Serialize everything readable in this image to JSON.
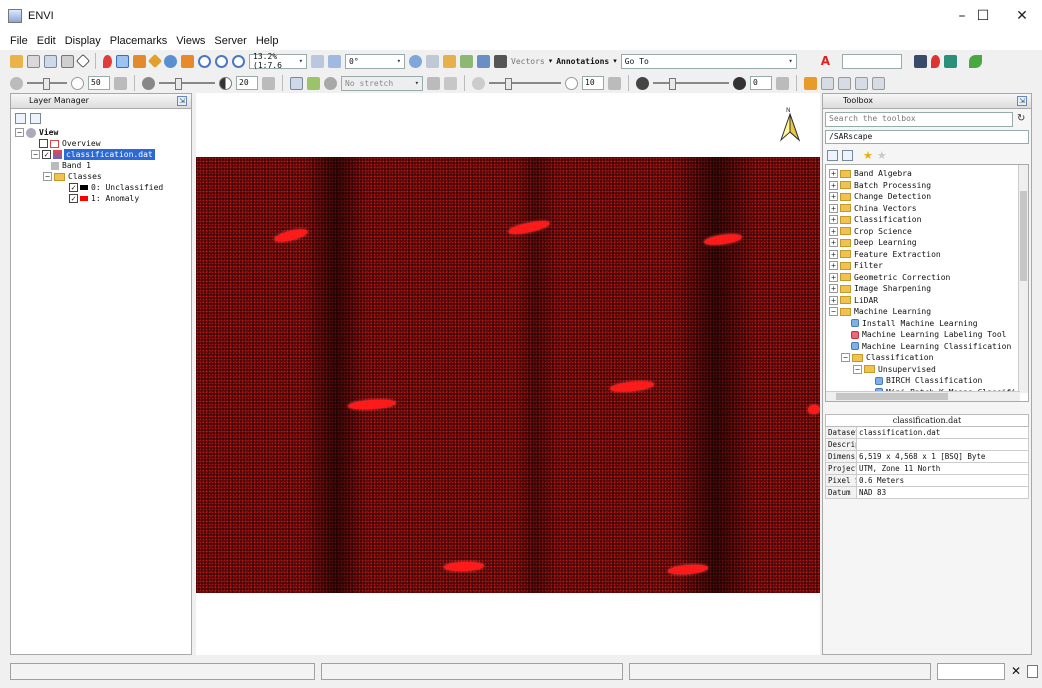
{
  "window": {
    "title": "ENVI",
    "min": "–",
    "max": "☐",
    "close": "✕"
  },
  "menu": [
    "File",
    "Edit",
    "Display",
    "Placemarks",
    "Views",
    "Server",
    "Help"
  ],
  "toolbar": {
    "zoom_value": "13.2% (1:7.6",
    "rotation_value": "0°",
    "vectors_label": "Vectors",
    "annotations_label": "Annotations",
    "goto_label": "Go To",
    "stretch_value": "No stretch",
    "brightness_value": "50",
    "contrast_value": "20",
    "sharpen_value": "10",
    "transparency_value": "0"
  },
  "layer_manager": {
    "title": "Layer Manager",
    "tree": {
      "view": "View",
      "overview": "Overview",
      "dataset": "classification.dat",
      "band": "Band 1",
      "classes": "Classes",
      "class0": "0: Unclassified",
      "class1": "1: Anomaly"
    },
    "class0_color": "#000000",
    "class1_color": "#ff0000"
  },
  "view": {
    "background": "#ffffff",
    "raster_color": "#3a0606",
    "target_color": "#ff1a1a"
  },
  "toolbox": {
    "title": "Toolbox",
    "search_placeholder": "Search the toolbox",
    "path": "/SARscape",
    "items": [
      "Band Algebra",
      "Batch Processing",
      "Change Detection",
      "China Vectors",
      "Classification",
      "Crop Science",
      "Deep Learning",
      "Feature Extraction",
      "Filter",
      "Geometric Correction",
      "Image Sharpening",
      "LiDAR",
      "Machine Learning"
    ],
    "ml_children": [
      "Install Machine Learning",
      "Machine Learning Labeling Tool",
      "Machine Learning Classification"
    ],
    "ml_classification": "Classification",
    "unsupervised": "Unsupervised",
    "unsupervised_children": [
      "BIRCH Classification",
      "Mini Batch K-Means Classifi"
    ]
  },
  "dataset_info": {
    "title": "classification.dat",
    "rows": [
      {
        "key": "Dataset Name",
        "value": "classification.dat"
      },
      {
        "key": "Description",
        "value": ""
      },
      {
        "key": "Dimensions",
        "value": "6,519 x 4,568 x 1 [BSQ] Byte"
      },
      {
        "key": "Projection",
        "value": "UTM, Zone 11 North"
      },
      {
        "key": "Pixel Size",
        "value": "0.6 Meters"
      },
      {
        "key": "Datum",
        "value": "NAD 83"
      }
    ]
  }
}
